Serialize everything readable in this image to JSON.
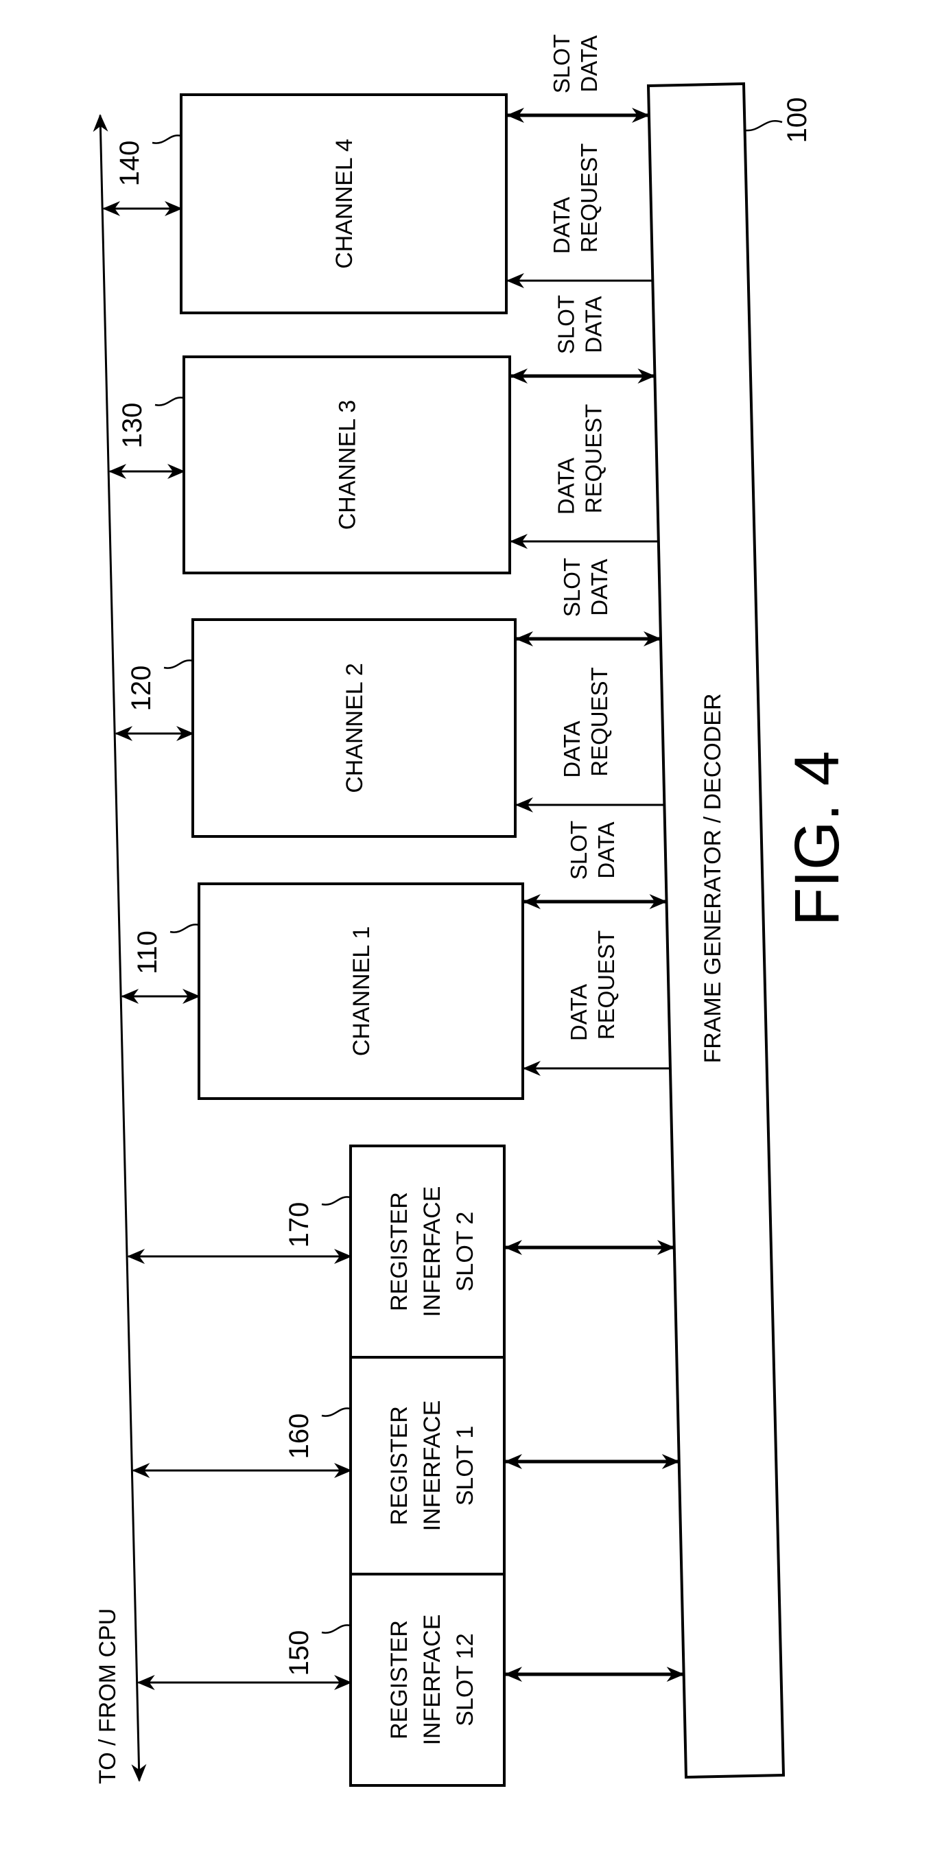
{
  "figure": {
    "title": "FIG. 4",
    "bus_label": "TO / FROM CPU",
    "frame_block": {
      "ref": "100",
      "label": "FRAME GENERATOR / DECODER"
    },
    "channels": [
      {
        "ref": "140",
        "label": "CHANNEL 4",
        "signals": [
          "SLOT DATA",
          "DATA REQUEST"
        ]
      },
      {
        "ref": "130",
        "label": "CHANNEL 3",
        "signals": [
          "SLOT DATA",
          "DATA REQUEST"
        ]
      },
      {
        "ref": "120",
        "label": "CHANNEL 2",
        "signals": [
          "SLOT DATA",
          "DATA REQUEST"
        ]
      },
      {
        "ref": "110",
        "label": "CHANNEL 1",
        "signals": [
          "SLOT DATA",
          "DATA REQUEST"
        ]
      }
    ],
    "register_interfaces": [
      {
        "ref": "170",
        "lines": [
          "REGISTER",
          "INFERFACE",
          "SLOT 2"
        ]
      },
      {
        "ref": "160",
        "lines": [
          "REGISTER",
          "INFERFACE",
          "SLOT 1"
        ]
      },
      {
        "ref": "150",
        "lines": [
          "REGISTER",
          "INFERFACE",
          "SLOT 12"
        ]
      }
    ],
    "signal_words": {
      "slot": "SLOT",
      "data": "DATA",
      "request": "REQUEST"
    }
  }
}
